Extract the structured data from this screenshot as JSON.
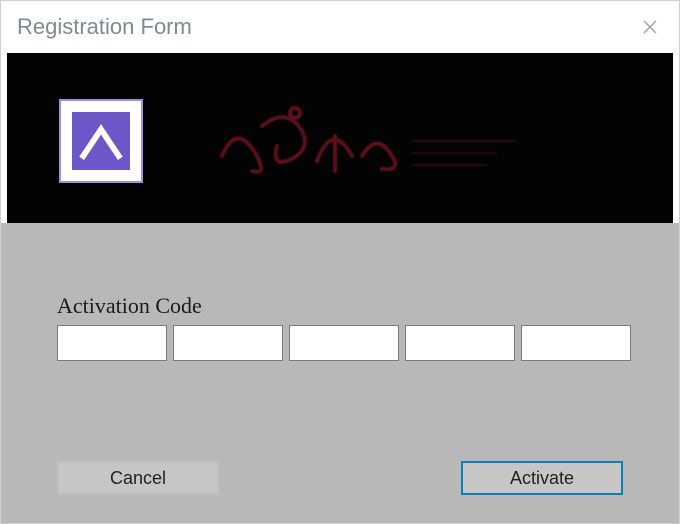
{
  "window": {
    "title": "Registration Form"
  },
  "form": {
    "activation_label": "Activation Code",
    "code_values": [
      "",
      "",
      "",
      "",
      ""
    ]
  },
  "buttons": {
    "cancel": "Cancel",
    "activate": "Activate"
  },
  "colors": {
    "banner_bg": "#030303",
    "content_bg": "#b8b8b8",
    "accent_purple": "#6e57c9",
    "brand_dark_red": "#6b1220",
    "activate_border": "#0a7fbe"
  }
}
